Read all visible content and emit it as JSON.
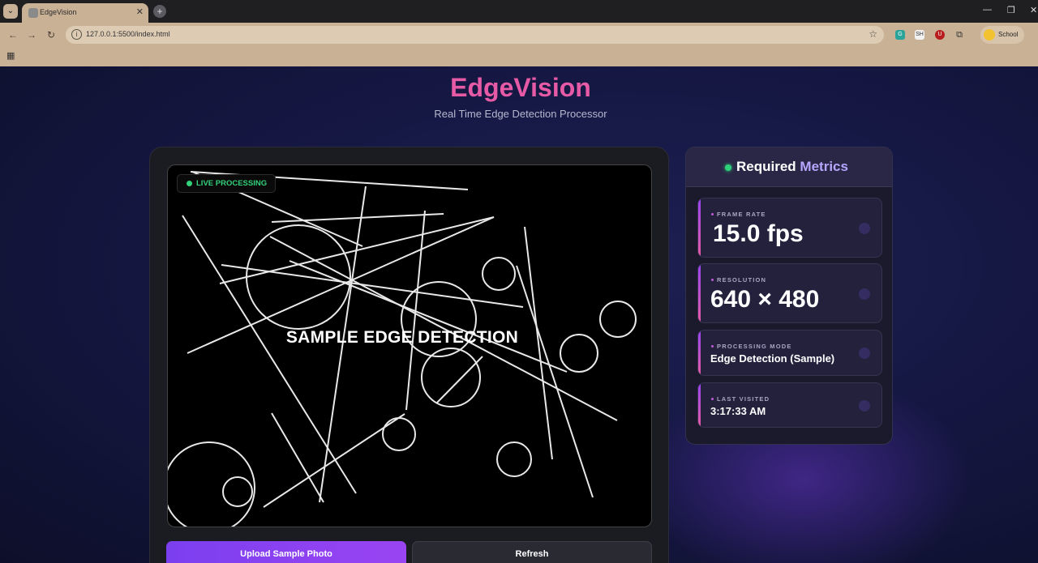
{
  "browser": {
    "tab_title": "EdgeVision",
    "tab_close": "✕",
    "new_tab": "+",
    "url": "127.0.0.1:5500/index.html",
    "profile_name": "School",
    "window_minimize": "—",
    "window_restore": "❐",
    "window_close": "✕"
  },
  "header": {
    "title": "EdgeVision",
    "subtitle": "Real Time Edge Detection Processor"
  },
  "preview": {
    "live_badge": "LIVE PROCESSING",
    "overlay_text": "SAMPLE EDGE DETECTION"
  },
  "actions": {
    "upload_label": "Upload Sample Photo",
    "refresh_label": "Refresh"
  },
  "metrics": {
    "title_main": "Required",
    "title_accent": "Metrics",
    "items": [
      {
        "label": "FRAME RATE",
        "value": "15.0 fps"
      },
      {
        "label": "RESOLUTION",
        "value": "640 × 480"
      },
      {
        "label": "PROCESSING MODE",
        "value": "Edge Detection (Sample)"
      },
      {
        "label": "LAST VISITED",
        "value": "3:17:33 AM"
      }
    ]
  },
  "colors": {
    "title_pink": "#e75aa6",
    "live_green": "#33d17a",
    "upload_purple": "#7b3ff0",
    "metrics_accent": "#b6a6ff"
  }
}
